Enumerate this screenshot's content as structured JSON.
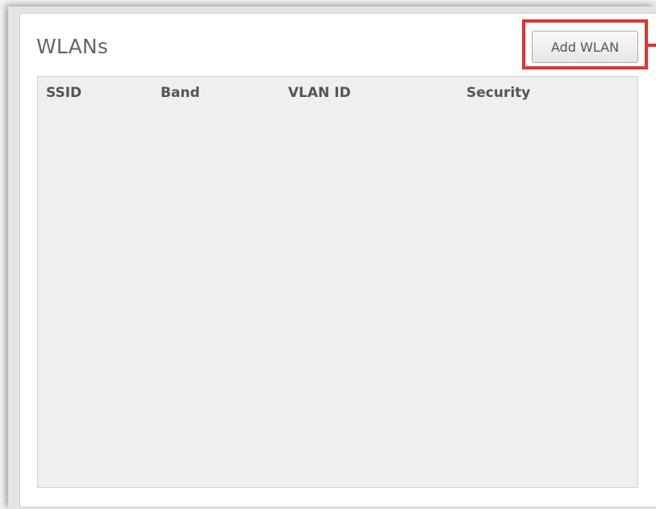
{
  "panel": {
    "title": "WLANs",
    "add_button_label": "Add WLAN"
  },
  "table": {
    "columns": [
      "SSID",
      "Band",
      "VLAN ID",
      "Security"
    ],
    "rows": []
  },
  "colors": {
    "highlight": "#e0352b",
    "title_text": "#666666",
    "header_text": "#555555",
    "table_background": "#efefef"
  }
}
